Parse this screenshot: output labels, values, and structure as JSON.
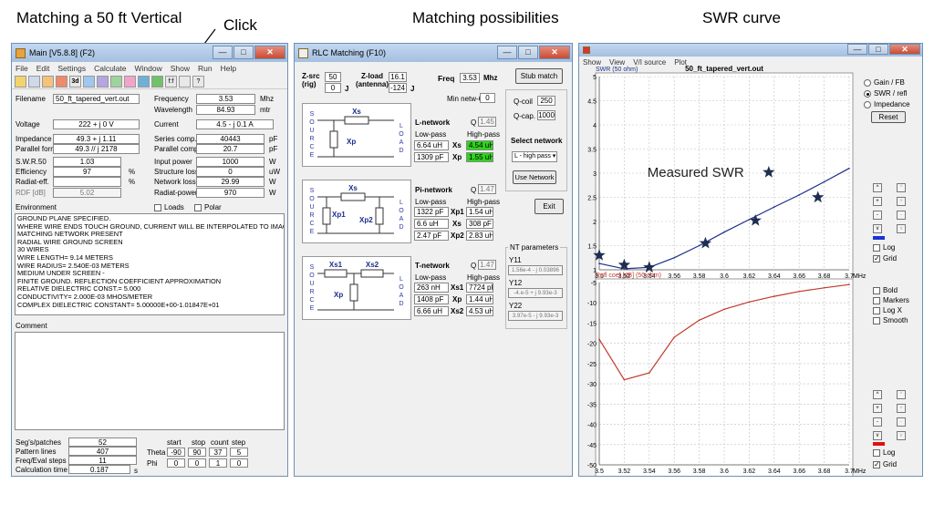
{
  "captions": {
    "left": "Matching a 50 ft Vertical",
    "click": "Click",
    "middle": "Matching possibilities",
    "right": "SWR curve"
  },
  "main": {
    "title": "Main [V5.8.8]   (F2)",
    "menu": [
      "File",
      "Edit",
      "Settings",
      "Calculate",
      "Window",
      "Show",
      "Run",
      "Help"
    ],
    "toolbar": [
      "save-icon",
      "open-icon",
      "antenna-icon",
      "3d-view-icon",
      "3d-icon",
      "geometry-icon",
      "ground-icon",
      "far-field-icon",
      "pattern-icon",
      "chart-icon",
      "match-icon",
      "help-icon"
    ],
    "filename_label": "Filename",
    "filename": "50_ft_tapered_vert.out",
    "frequency_label": "Frequency",
    "frequency": "3.53",
    "frequency_unit": "Mhz",
    "wavelength_label": "Wavelength",
    "wavelength": "84.93",
    "wavelength_unit": "mtr",
    "voltage_label": "Voltage",
    "voltage": "222 + j 0 V",
    "current_label": "Current",
    "current": "4.5 - j 0.1 A",
    "impedance_label": "Impedance",
    "impedance": "49.3 + j 1.11",
    "parallel_label": "Parallel form",
    "parallel": "49.3 // j 2178",
    "swr_label": "S.W.R.50",
    "swr": "1.03",
    "eff_label": "Efficiency",
    "eff": "97",
    "eff_unit": "%",
    "radeff_label": "Radiat-eff.",
    "radeff_unit": "%",
    "rdf_label": "RDF [dB]",
    "rdf": "5.02",
    "series_label": "Series comp.",
    "series": "40443",
    "series_unit": "pF",
    "parcomp_label": "Parallel comp.",
    "parcomp": "20.7",
    "parcomp_unit": "pF",
    "input_label": "Input power",
    "input": "1000",
    "input_unit": "W",
    "struct_label": "Structure loss",
    "struct": "0",
    "struct_unit": "uW",
    "netloss_label": "Network loss",
    "netloss": "29.99",
    "netloss_unit": "W",
    "radpow_label": "Radiat-power",
    "radpow": "970",
    "radpow_unit": "W",
    "environment_label": "Environment",
    "loads_label": "Loads",
    "polar_label": "Polar",
    "env_lines": [
      "GROUND PLANE SPECIFIED.",
      "WHERE WIRE ENDS TOUCH GROUND, CURRENT WILL BE INTERPOLATED TO IMAGE IN GRO",
      "MATCHING NETWORK PRESENT",
      "RADIAL WIRE GROUND SCREEN",
      "30 WIRES",
      "WIRE LENGTH=   9.14 METERS",
      "WIRE RADIUS= 2.540E-03 METERS",
      "MEDIUM UNDER SCREEN -",
      "FINITE GROUND.  REFLECTION COEFFICIENT APPROXIMATION",
      "RELATIVE DIELECTRIC CONST.=  5.000",
      "CONDUCTIVITY= 2.000E-03 MHOS/METER",
      "COMPLEX DIELECTRIC CONSTANT= 5.00000E+00-1.01847E+01"
    ],
    "comment_label": "Comment",
    "segs_label": "Seg's/patches",
    "segs": "52",
    "pattern_label": "Pattern lines",
    "pattern": "407",
    "freqeval_label": "Freq/Eval steps",
    "freqeval": "11",
    "calc_label": "Calculation time",
    "calc": "0.187",
    "calc_unit": "s",
    "start_label": "start",
    "stop_label": "stop",
    "count_label": "count",
    "step_label": "step",
    "theta_label": "Theta",
    "theta": [
      "-90",
      "90",
      "37",
      "5"
    ],
    "phi_label": "Phi",
    "phi": [
      "0",
      "0",
      "1",
      "0"
    ]
  },
  "rlc": {
    "title": "RLC Matching  (F10)",
    "zsrc_label": "Z-src\n(rig)",
    "zsrc_r": "50",
    "zsrc_x": "0",
    "j": "J",
    "zload_label": "Z-load\n(antenna)",
    "zload_r": "16.1",
    "zload_x": "-124",
    "freq_label": "Freq",
    "freq": "3.53",
    "freq_unit": "Mhz",
    "minq_label": "Min netw-Q",
    "minq": "0",
    "stub_button": "Stub match",
    "qcoil_label": "Q-coil",
    "qcoil": "250",
    "qcap_label": "Q-cap.",
    "qcap": "1000",
    "select_label": "Select network",
    "select_value": "L - high pass",
    "use_button": "Use Network",
    "exit_button": "Exit",
    "source_letters": [
      "S",
      "O",
      "U",
      "R",
      "C",
      "E"
    ],
    "load_letters": [
      "L",
      "O",
      "A",
      "D"
    ],
    "lnet": {
      "name": "L-network",
      "q_label": "Q",
      "q": "1.45",
      "lp": "Low-pass",
      "hp": "High-pass",
      "rows": [
        {
          "lp": "6.64 uH",
          "label": "Xs",
          "hp": "4.54 uH"
        },
        {
          "lp": "1309 pF",
          "label": "Xp",
          "hp": "1.55 uH"
        }
      ],
      "sym": [
        "Xs",
        "Xp"
      ]
    },
    "pinet": {
      "name": "Pi-network",
      "q_label": "Q",
      "q": "1.47",
      "lp": "Low-pass",
      "hp": "High-pass",
      "rows": [
        {
          "lp": "1322 pF",
          "label": "Xp1",
          "hp": "1.54 uH"
        },
        {
          "lp": "6.6 uH",
          "label": "Xs",
          "hp": "308 pF"
        },
        {
          "lp": "2.47 pF",
          "label": "Xp2",
          "hp": "2.83 uH"
        }
      ],
      "sym": [
        "Xs",
        "Xp1",
        "Xp2"
      ]
    },
    "tnet": {
      "name": "T-network",
      "q_label": "Q",
      "q": "1.47",
      "lp": "Low-pass",
      "hp": "High-pass",
      "rows": [
        {
          "lp": "263 nH",
          "label": "Xs1",
          "hp": "7724 pF"
        },
        {
          "lp": "1408 pF",
          "label": "Xp",
          "hp": "1.44 uH"
        },
        {
          "lp": "6.66 uH",
          "label": "Xs2",
          "hp": "4.53 uH"
        }
      ],
      "sym": [
        "Xs1",
        "Xs2",
        "Xp"
      ]
    },
    "nt_label": "NT parameters",
    "y11_label": "Y11",
    "y11": "1.56e-4 - j 0.03896",
    "y12_label": "Y12",
    "y12": "-4.e-5 + j 9.93e-3",
    "y22_label": "Y22",
    "y22": "3.97e-5 - j 9.93e-3"
  },
  "swr": {
    "menu": [
      "Show",
      "View",
      "V/I source",
      "Plot"
    ],
    "options": {
      "gain": "Gain / FB",
      "swr": "SWR / refl",
      "imp": "Impedance",
      "reset": "Reset"
    },
    "checks1": {
      "log": "Log",
      "grid": "Grid"
    },
    "checks_mid": [
      "Bold",
      "Markers",
      "Log X",
      "Smooth"
    ],
    "checks2": {
      "log": "Log",
      "grid": "Grid"
    },
    "scroll_btn_labels": [
      "^",
      "+",
      "-",
      "v"
    ],
    "color1": "#1a33d6",
    "color2": "#e01010"
  },
  "chart_data": [
    {
      "type": "line",
      "title": "50_ft_tapered_vert.out",
      "ylabel": "SWR (50 ohm)",
      "xlabel": "MHz",
      "xlim": [
        3.5,
        3.7
      ],
      "ylim": [
        1,
        5
      ],
      "xticks": [
        "3.5",
        "3.52",
        "3.54",
        "3.56",
        "3.58",
        "3.6",
        "3.62",
        "3.64",
        "3.66",
        "3.68",
        "3.7"
      ],
      "yticks": [
        "1",
        "1.5",
        "2",
        "2.5",
        "3",
        "3.5",
        "4",
        "4.5",
        "5"
      ],
      "series": [
        {
          "x": [
            3.5,
            3.52,
            3.54,
            3.56,
            3.58,
            3.6,
            3.62,
            3.64,
            3.66,
            3.68,
            3.7
          ],
          "values": [
            1.13,
            1.02,
            1.05,
            1.25,
            1.5,
            1.78,
            2.04,
            2.3,
            2.55,
            2.82,
            3.1
          ]
        }
      ],
      "markers": {
        "label": "Measured SWR",
        "x": [
          3.5,
          3.52,
          3.54,
          3.585,
          3.625,
          3.675
        ],
        "values": [
          1.3,
          1.1,
          1.05,
          1.55,
          2.02,
          2.5
        ]
      },
      "grid": true,
      "color": "#1a2e8a"
    },
    {
      "type": "line",
      "ylabel": "Refl coef [dB] (50 ohm)",
      "xlabel": "MHz",
      "xlim": [
        3.5,
        3.7
      ],
      "ylim": [
        -50,
        -5
      ],
      "xticks": [
        "3.5",
        "3.52",
        "3.54",
        "3.56",
        "3.58",
        "3.6",
        "3.62",
        "3.64",
        "3.66",
        "3.68",
        "3.7"
      ],
      "yticks": [
        "-5",
        "-10",
        "-15",
        "-20",
        "-25",
        "-30",
        "-35",
        "-40",
        "-45",
        "-50"
      ],
      "series": [
        {
          "x": [
            3.5,
            3.52,
            3.54,
            3.56,
            3.58,
            3.6,
            3.62,
            3.64,
            3.66,
            3.68,
            3.7
          ],
          "values": [
            -19,
            -29,
            -27.3,
            -18.5,
            -14.3,
            -11.6,
            -9.8,
            -8.4,
            -7.2,
            -6.3,
            -5.5
          ]
        }
      ],
      "grid": true,
      "color": "#c0392b"
    }
  ]
}
